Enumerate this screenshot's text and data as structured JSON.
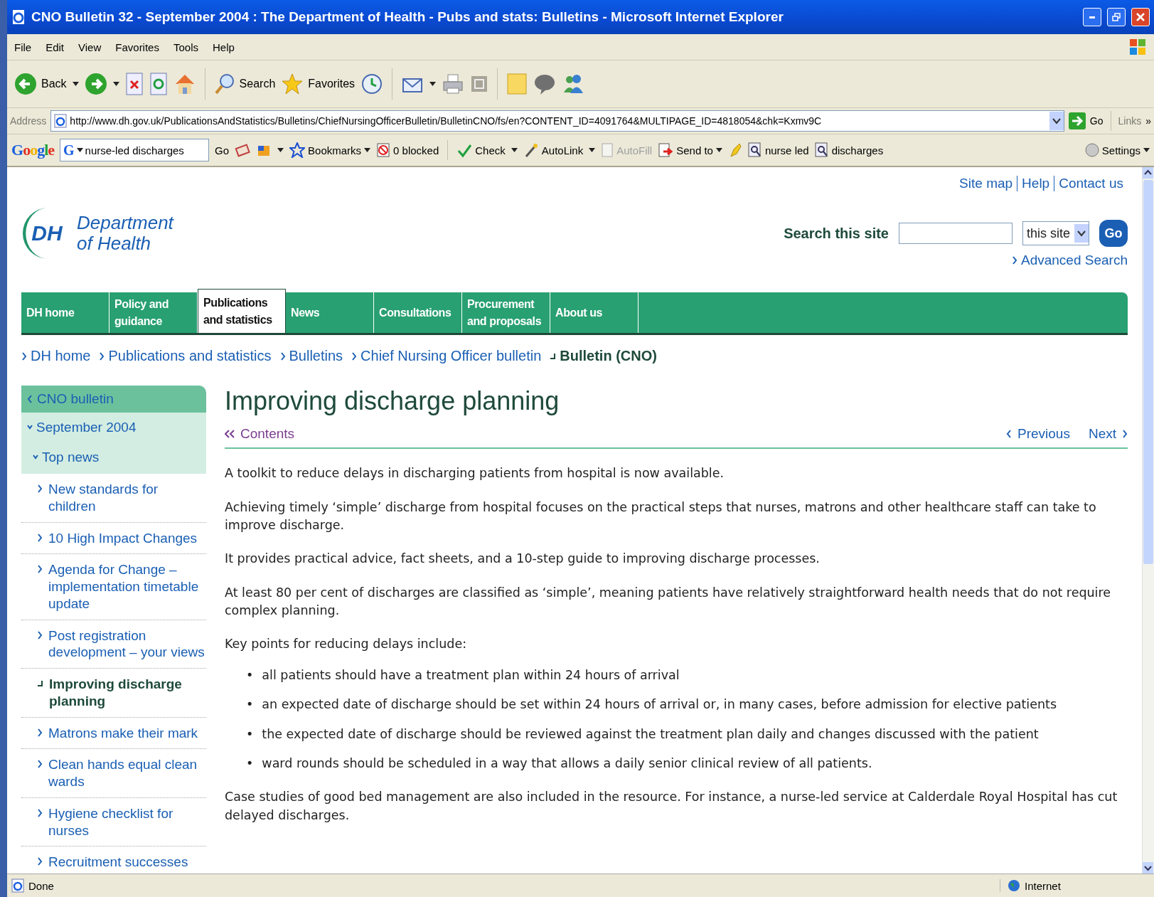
{
  "window": {
    "title": "CNO Bulletin 32 - September 2004 : The Department of Health - Pubs and stats: Bulletins - Microsoft Internet Explorer"
  },
  "menu": [
    "File",
    "Edit",
    "View",
    "Favorites",
    "Tools",
    "Help"
  ],
  "toolbar": {
    "back": "Back",
    "search": "Search",
    "favorites": "Favorites"
  },
  "address": {
    "label": "Address",
    "value": "http://www.dh.gov.uk/PublicationsAndStatistics/Bulletins/ChiefNursingOfficerBulletin/BulletinCNO/fs/en?CONTENT_ID=4091764&MULTIPAGE_ID=4818054&chk=Kxmv9C",
    "go": "Go",
    "links": "Links",
    "more": "»"
  },
  "google_bar": {
    "logo": "Google",
    "field_logo": "G",
    "query": "nurse-led discharges",
    "go": "Go",
    "bookmarks": "Bookmarks",
    "blocked": "0 blocked",
    "check": "Check",
    "autolink": "AutoLink",
    "autofill": {
      "label": "AutoFill",
      "disabled": true
    },
    "send_to": "Send to",
    "terms": [
      "nurse led",
      "discharges"
    ],
    "settings": "Settings"
  },
  "page": {
    "top_links": [
      "Site map",
      "Help",
      "Contact us"
    ],
    "logo": {
      "initials": "DH",
      "line1": "Department",
      "line2": "of Health"
    },
    "search": {
      "label": "Search this site",
      "scope": "this site",
      "go": "Go",
      "advanced": "Advanced Search"
    },
    "nav": [
      {
        "label": "DH home",
        "selected": false
      },
      {
        "label": "Policy and guidance",
        "selected": false
      },
      {
        "label": "Publications and statistics",
        "selected": true
      },
      {
        "label": "News",
        "selected": false
      },
      {
        "label": "Consultations",
        "selected": false
      },
      {
        "label": "Procurement and proposals",
        "selected": false
      },
      {
        "label": "About us",
        "selected": false
      }
    ],
    "breadcrumb": [
      {
        "label": "DH home",
        "current": false
      },
      {
        "label": "Publications and statistics",
        "current": false
      },
      {
        "label": "Bulletins",
        "current": false
      },
      {
        "label": "Chief Nursing Officer bulletin",
        "current": false
      },
      {
        "label": "Bulletin (CNO)",
        "current": true
      }
    ],
    "sidebar": {
      "back": "CNO bulletin",
      "section": "September 2004",
      "subsection": "Top news",
      "items": [
        {
          "label": "New standards for children",
          "selected": false
        },
        {
          "label": "10 High Impact Changes",
          "selected": false
        },
        {
          "label": "Agenda for Change – implementation timetable update",
          "selected": false
        },
        {
          "label": "Post registration development – your views",
          "selected": false
        },
        {
          "label": "Improving discharge planning",
          "selected": true
        },
        {
          "label": "Matrons make their mark",
          "selected": false
        },
        {
          "label": "Clean hands equal clean wards",
          "selected": false
        },
        {
          "label": "Hygiene checklist for nurses",
          "selected": false
        },
        {
          "label": "Recruitment successes",
          "selected": false
        }
      ]
    },
    "article": {
      "title": "Improving discharge planning",
      "contents": "Contents",
      "previous": "Previous",
      "next": "Next",
      "blocks": [
        {
          "kind": "paragraph",
          "text": "A toolkit to reduce delays in discharging patients from hospital is now available."
        },
        {
          "kind": "paragraph",
          "text": "Achieving timely ‘simple’ discharge from hospital focuses on the practical steps that nurses, matrons and other healthcare staff can take to improve discharge."
        },
        {
          "kind": "paragraph",
          "text": "It provides practical advice, fact sheets, and a 10-step guide to improving discharge processes."
        },
        {
          "kind": "paragraph",
          "text": "At least 80 per cent of discharges are classified as ‘simple’, meaning patients have relatively straightforward health needs that do not require complex planning."
        },
        {
          "kind": "paragraph",
          "text": "Key points for reducing delays include:"
        },
        {
          "kind": "bullets",
          "marker": "•",
          "items": [
            "all patients should have a treatment plan within 24 hours of arrival",
            "an expected date of discharge should be set within 24 hours of arrival or, in many cases, before admission for elective patients",
            "the expected date of discharge should be reviewed against the treatment plan daily and changes discussed with the patient",
            "ward rounds should be scheduled in a way that allows a daily senior clinical review of all patients."
          ]
        },
        {
          "kind": "paragraph",
          "text": "Case studies of good bed management are also included in the resource. For instance, a nurse-led service at Calderdale Royal Hospital has cut delayed discharges."
        }
      ]
    }
  },
  "status_bar": {
    "text": "Done",
    "zone": "Internet"
  }
}
